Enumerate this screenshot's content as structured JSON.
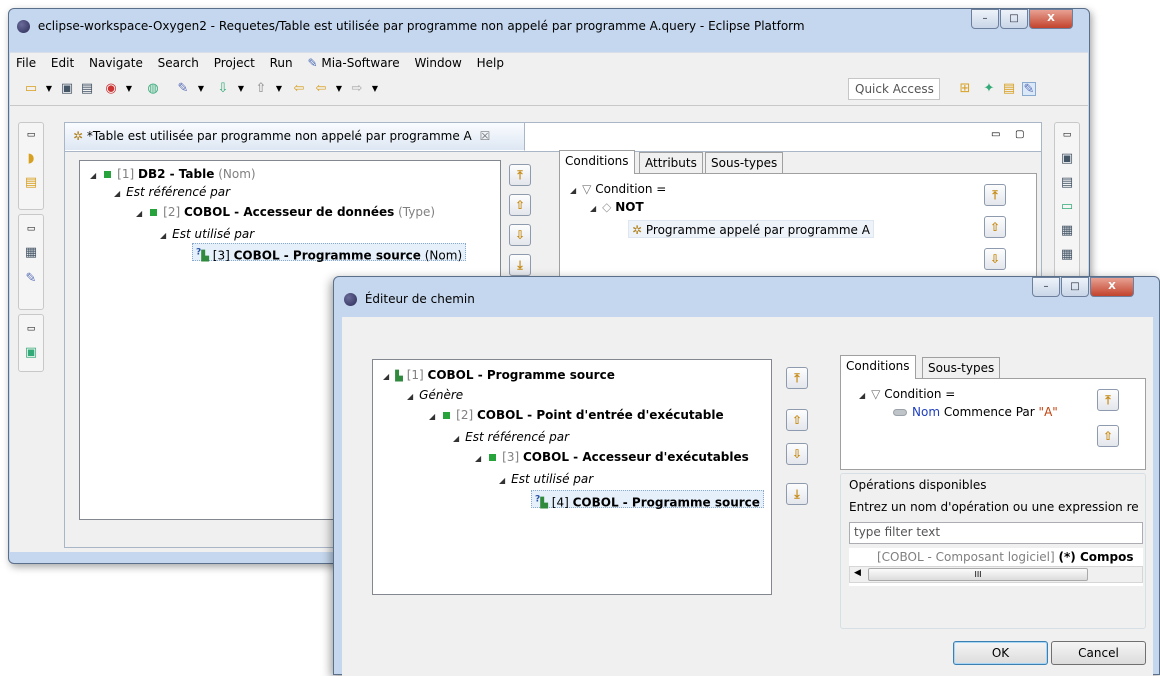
{
  "main_window": {
    "title": "eclipse-workspace-Oxygen2 - Requetes/Table est utilisée par programme non appelé par programme A.query - Eclipse Platform",
    "controls": {
      "minimize": "–",
      "maximize": "□",
      "close": "X"
    },
    "menu": [
      "File",
      "Edit",
      "Navigate",
      "Search",
      "Project",
      "Run",
      "Mia-Software",
      "Window",
      "Help"
    ],
    "quick_access": "Quick Access",
    "editor_tab": {
      "label": "*Table est utilisée par programme non appelé par programme A",
      "close_glyph": "☒"
    },
    "path_tree": [
      {
        "id": "[1]",
        "name": "DB2 - Table",
        "suffix": "(Nom)"
      },
      {
        "label": "Est référencé par"
      },
      {
        "id": "[2]",
        "name": "COBOL - Accesseur de données",
        "suffix": "(Type)"
      },
      {
        "label": "Est utilisé par"
      },
      {
        "id": "[3]",
        "name": "COBOL - Programme source",
        "suffix": "(Nom)"
      }
    ],
    "tabs": [
      "Conditions",
      "Attributs",
      "Sous-types"
    ],
    "conditions_tree": {
      "root": "Condition =",
      "not": "NOT",
      "leaf": "Programme appelé par programme A"
    }
  },
  "dialog": {
    "title": "Éditeur de chemin",
    "controls": {
      "minimize": "–",
      "maximize": "□",
      "close": "X"
    },
    "path_tree": [
      {
        "id": "[1]",
        "name": "COBOL - Programme source"
      },
      {
        "label": "Génère"
      },
      {
        "id": "[2]",
        "name": "COBOL - Point d'entrée d'exécutable"
      },
      {
        "label": "Est référencé par"
      },
      {
        "id": "[3]",
        "name": "COBOL - Accesseur d'exécutables"
      },
      {
        "label": "Est utilisé par"
      },
      {
        "id": "[4]",
        "name": "COBOL - Programme source"
      }
    ],
    "tabs": [
      "Conditions",
      "Sous-types"
    ],
    "condition": {
      "root": "Condition =",
      "attribute": "Nom",
      "operator": "Commence Par",
      "value": "\"A\""
    },
    "operations": {
      "group_label": "Opérations disponibles",
      "hint": "Entrez un nom d'opération ou une expression re",
      "filter_placeholder": "type filter text",
      "partial_item_prefix": "[COBOL - Composant logiciel]",
      "partial_item_bold": "(*) Compos",
      "scroll_thumb": "III"
    },
    "buttons": {
      "ok": "OK",
      "cancel": "Cancel"
    }
  }
}
